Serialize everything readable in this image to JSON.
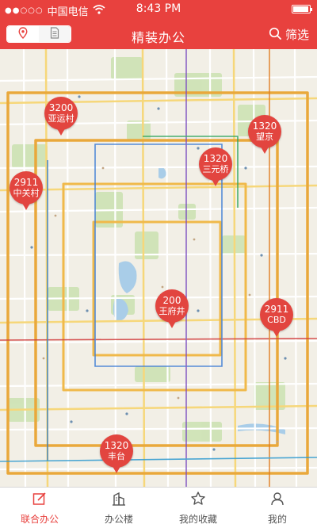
{
  "status_bar": {
    "carrier": "中国电信",
    "time": "8:43 PM",
    "signal_dots": "●●○○○",
    "battery_level": 0.85
  },
  "header": {
    "title": "精装办公",
    "filter_label": "筛选",
    "view_toggle": {
      "map_icon": "location-pin-icon",
      "list_icon": "document-icon",
      "active": "map"
    }
  },
  "map": {
    "pins": [
      {
        "count": "3200",
        "area": "亚运村"
      },
      {
        "count": "1320",
        "area": "望京"
      },
      {
        "count": "1320",
        "area": "三元桥"
      },
      {
        "count": "2911",
        "area": "中关村"
      },
      {
        "count": "200",
        "area": "王府井"
      },
      {
        "count": "2911",
        "area": "CBD"
      },
      {
        "count": "1320",
        "area": "丰台"
      }
    ]
  },
  "tabbar": {
    "items": [
      {
        "label": "联合办公",
        "icon": "edit-icon",
        "active": true
      },
      {
        "label": "办公楼",
        "icon": "building-icon",
        "active": false
      },
      {
        "label": "我的收藏",
        "icon": "star-icon",
        "active": false
      },
      {
        "label": "我的",
        "icon": "person-icon",
        "active": false
      }
    ]
  },
  "colors": {
    "brand_red": "#e8413e",
    "pin_red": "#e2453f",
    "map_background": "#f2efe6",
    "water_blue": "#a9cde8",
    "park_green": "#cfe3b6"
  }
}
